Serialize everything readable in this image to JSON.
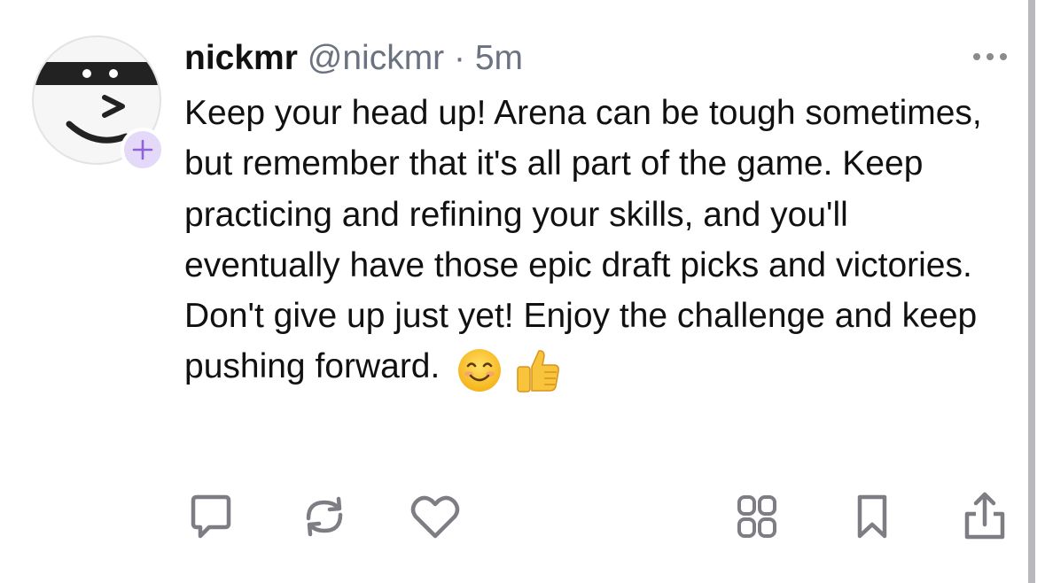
{
  "post": {
    "author": {
      "display_name": "nickmr",
      "handle": "@nickmr",
      "separator": "·",
      "timestamp": "5m",
      "avatar_icon": "masked-smiley-avatar",
      "follow_icon": "plus-icon"
    },
    "body": "Keep your head up! Arena can be tough sometimes, but remember that it's all part of the game. Keep practicing and refining your skills, and you'll eventually have those epic draft picks and victories. Don't give up just yet! Enjoy the challenge and keep pushing forward.",
    "emojis": [
      "smiling-face-emoji",
      "thumbs-up-emoji"
    ],
    "more_icon": "ellipsis-icon",
    "actions": [
      {
        "name": "reply",
        "icon": "comment-icon"
      },
      {
        "name": "repost",
        "icon": "repost-icon"
      },
      {
        "name": "like",
        "icon": "heart-icon"
      },
      {
        "name": "bingo",
        "icon": "grid-icon"
      },
      {
        "name": "save",
        "icon": "bookmark-icon"
      },
      {
        "name": "share",
        "icon": "share-icon"
      }
    ]
  },
  "colors": {
    "text": "#111111",
    "secondary_text": "#6b7280",
    "icon": "#7d7d83",
    "follow_badge_bg": "#e4d9f8",
    "follow_badge_fg": "#8e63d8"
  }
}
